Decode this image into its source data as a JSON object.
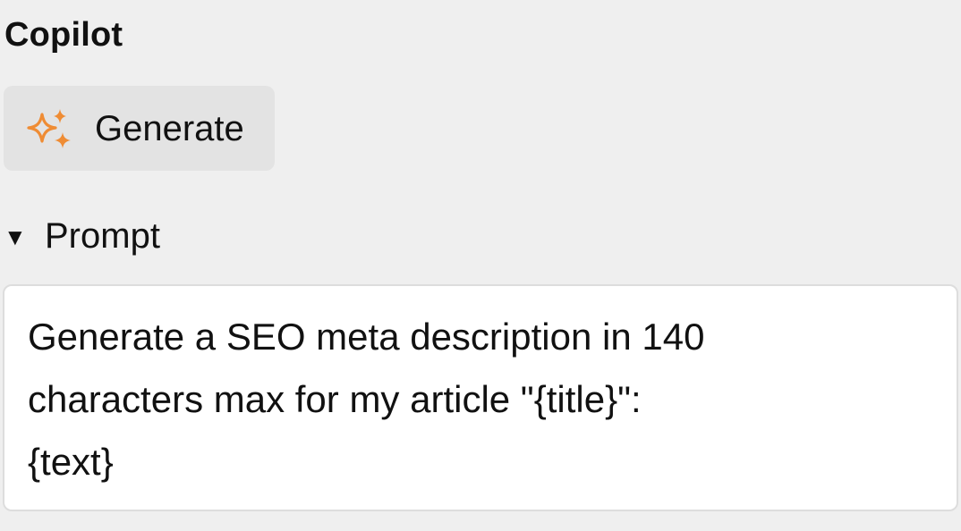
{
  "panel": {
    "title": "Copilot"
  },
  "generate_button": {
    "label": "Generate",
    "icon": "sparkle-icon",
    "icon_color": "#ef8c34"
  },
  "prompt_section": {
    "label": "Prompt",
    "toggle_icon": "caret-down-icon",
    "text": "Generate a SEO meta description in 140\ncharacters max for my article \"{title}\":\n{text}"
  }
}
